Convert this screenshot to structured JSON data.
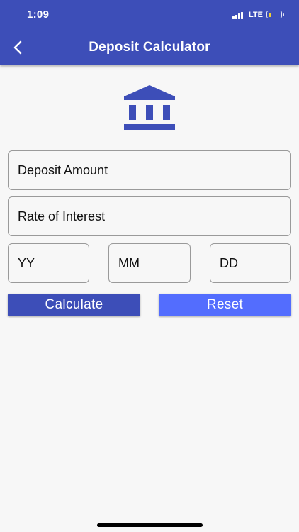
{
  "status_bar": {
    "time": "1:09",
    "network": "LTE"
  },
  "header": {
    "title": "Deposit Calculator",
    "back_icon": "chevron-left-icon"
  },
  "logo": {
    "icon": "bank-icon"
  },
  "form": {
    "amount_placeholder": "Deposit Amount",
    "rate_placeholder": "Rate of Interest",
    "years_placeholder": "YY",
    "months_placeholder": "MM",
    "days_placeholder": "DD"
  },
  "actions": {
    "calculate_label": "Calculate",
    "reset_label": "Reset"
  },
  "colors": {
    "primary": "#3d4eb8",
    "accent": "#536dfe",
    "background": "#f7f7f7"
  }
}
